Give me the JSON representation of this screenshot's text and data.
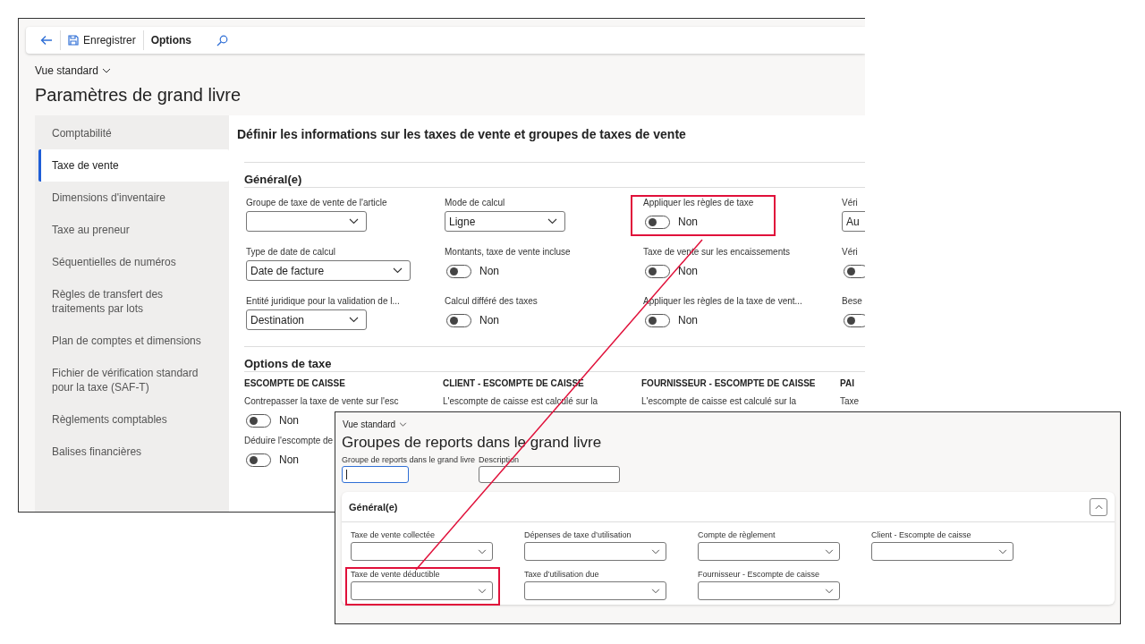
{
  "back_window": {
    "toolbar": [
      {
        "kind": "back"
      },
      {
        "kind": "save",
        "label": "Enregistrer"
      },
      {
        "kind": "text",
        "label": "Options"
      },
      {
        "kind": "search"
      }
    ],
    "view": "Vue standard",
    "title": "Paramètres de grand livre",
    "nav": [
      {
        "label": "Comptabilité",
        "selected": false
      },
      {
        "label": "Taxe de vente",
        "selected": true
      },
      {
        "label": "Dimensions d'inventaire",
        "selected": false
      },
      {
        "label": "Taxe au preneur",
        "selected": false
      },
      {
        "label": "Séquentielles de numéros",
        "selected": false
      },
      {
        "label": "Règles de transfert des traitements par lots",
        "selected": false
      },
      {
        "label": "Plan de comptes et dimensions",
        "selected": false
      },
      {
        "label": "Fichier de vérification standard pour la taxe (SAF-T)",
        "selected": false
      },
      {
        "label": "Règlements comptables",
        "selected": false
      },
      {
        "label": "Balises financières",
        "selected": false
      }
    ],
    "heading": "Définir les informations sur les taxes de vente et groupes de taxes de vente",
    "general": {
      "title": "Général(e)",
      "columns": [
        [
          {
            "label": "Groupe de taxe de vente de l'article",
            "kind": "select",
            "highlighted": false
          },
          {
            "label": "Type de date de calcul",
            "kind": "select",
            "value": "Date de facture",
            "highlighted": false
          },
          {
            "label": "Entité juridique pour la validation de l...",
            "kind": "select",
            "value": "Destination",
            "highlighted": false
          }
        ],
        [
          {
            "label": "Mode de calcul",
            "kind": "select",
            "value": "Ligne",
            "highlighted": false
          },
          {
            "label": "Montants, taxe de vente incluse",
            "kind": "toggle",
            "on": false,
            "value": "Non",
            "highlighted": false
          },
          {
            "label": "Calcul différé des taxes",
            "kind": "toggle",
            "on": false,
            "value": "Non",
            "highlighted": false
          }
        ],
        [
          {
            "label": "Appliquer les règles de taxe",
            "kind": "toggle",
            "on": false,
            "value": "Non",
            "highlighted": true
          },
          {
            "label": "Taxe de vente sur les encaissements",
            "kind": "toggle",
            "on": false,
            "value": "Non",
            "highlighted": false
          },
          {
            "label": "Appliquer les règles de la taxe de vent...",
            "kind": "toggle",
            "on": false,
            "value": "Non",
            "highlighted": false
          }
        ],
        [
          {
            "label": "Véri",
            "kind": "select",
            "value": "Au",
            "highlighted": false
          },
          {
            "label": "Véri",
            "kind": "toggle",
            "on": false,
            "highlighted": false
          },
          {
            "label": "Bese",
            "kind": "toggle",
            "on": false,
            "highlighted": false
          }
        ]
      ]
    },
    "options": {
      "title": "Options de taxe",
      "columns": [
        {
          "heading": "ESCOMPTE DE CAISSE",
          "fields": [
            {
              "label": "Contrepasser la taxe de vente sur l'esc",
              "kind": "toggle",
              "on": false,
              "value": "Non"
            },
            {
              "label": "Déduire l'escompte de",
              "kind": "toggle",
              "on": false,
              "value": "Non"
            }
          ]
        },
        {
          "heading": "CLIENT - ESCOMPTE DE CAISSE",
          "fields": [
            {
              "label": "L'escompte de caisse est calculé sur la",
              "kind": "label"
            }
          ]
        },
        {
          "heading": "FOURNISSEUR - ESCOMPTE DE CAISSE",
          "fields": [
            {
              "label": "L'escompte de caisse est calculé sur la",
              "kind": "label"
            }
          ]
        },
        {
          "heading": "PAI",
          "fields": [
            {
              "label": "Taxe",
              "kind": "label"
            }
          ]
        }
      ]
    }
  },
  "front_window": {
    "view": "Vue standard",
    "title": "Groupes de reports dans le grand livre",
    "inputs": [
      {
        "label": "Groupe de reports dans le grand livre",
        "focused": true
      },
      {
        "label": "Description",
        "focused": false
      }
    ],
    "card": {
      "title": "Général(e)",
      "expanded": true,
      "rows": [
        [
          {
            "label": "Taxe de vente collectée",
            "highlighted": false
          },
          {
            "label": "Dépenses de taxe d’utilisation",
            "highlighted": false
          },
          {
            "label": "Compte de règlement",
            "highlighted": false
          },
          {
            "label": "Client - Escompte de caisse",
            "highlighted": false
          }
        ],
        [
          {
            "label": "Taxe de vente déductible",
            "highlighted": true
          },
          {
            "label": "Taxe d’utilisation due",
            "highlighted": false
          },
          {
            "label": "Fournisseur - Escompte de caisse",
            "highlighted": false
          }
        ]
      ]
    }
  }
}
